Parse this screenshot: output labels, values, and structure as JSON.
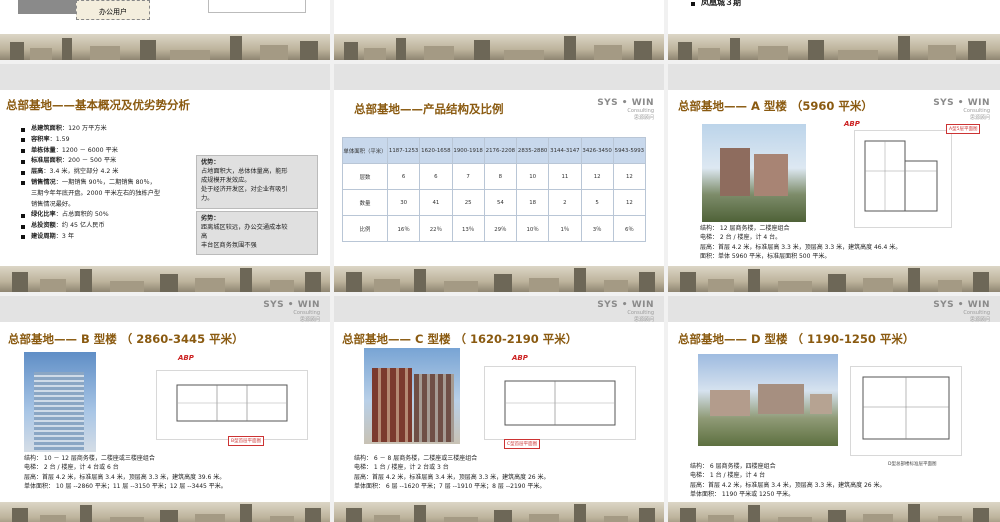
{
  "top_row": {
    "left_box_text": "办公用户",
    "right_bullet": "凤凰城３期"
  },
  "brand": {
    "logo": "SYS • WIN",
    "sub1": "Consulting",
    "sub2": "思源顾问"
  },
  "slide1": {
    "title": "总部基地——基本概况及优劣势分析",
    "bullets": [
      {
        "label": "总建筑面积",
        "value": "：120 万平方米"
      },
      {
        "label": "容积率",
        "value": "：1.59"
      },
      {
        "label": "单栋体量",
        "value": "：1200 － 6000 平米"
      },
      {
        "label": "标准层面积",
        "value": "：200 － 500 平米"
      },
      {
        "label": "层高",
        "value": "：3.4 米，挑空部分 4.2 米"
      },
      {
        "label": "销售情况",
        "value": "：一期销售 90％，二期销售 80％，",
        "extra": [
          "三期今年年底开盘。2000 平米左右的独栋户型",
          "销售情况最好。"
        ]
      },
      {
        "label": "绿化比率",
        "value": "：占总面积的 50%"
      },
      {
        "label": "总投资额",
        "value": "：约 45 亿人民币"
      },
      {
        "label": "建设周期",
        "value": "：3 年"
      }
    ],
    "adv_title": "优势：",
    "adv_lines": [
      "占地面积大，总体体量高，能形",
      "成规模开发效应。",
      "处于经济开发区，对企业有吸引",
      "力。"
    ],
    "dis_title": "劣势：",
    "dis_lines": [
      "距离城区较远，办公交通成本较",
      "高",
      "丰台区商务氛围不强"
    ]
  },
  "slide2": {
    "title": "总部基地——产品结构及比例",
    "table": {
      "header": [
        "单体面积（平米）",
        "1187-1253",
        "1620-1658",
        "1900-1918",
        "2176-2208",
        "2835-2880",
        "3144-3147",
        "3426-3450",
        "5943-5993"
      ],
      "rows": [
        [
          "层数",
          "6",
          "6",
          "7",
          "8",
          "10",
          "11",
          "12",
          "12"
        ],
        [
          "数量",
          "30",
          "41",
          "25",
          "54",
          "18",
          "2",
          "5",
          "12"
        ],
        [
          "比例",
          "16％",
          "22％",
          "13％",
          "29％",
          "10％",
          "1％",
          "3％",
          "6％"
        ]
      ]
    }
  },
  "slide3": {
    "title": "总部基地—— A 型楼 （5960 平米）",
    "brand_mark": "ABP",
    "plan_tag": "A型5层平面图",
    "caption": [
      "结构： 12 层商务楼，二楼座组合",
      "电梯： 2 台 / 楼座，计 4 台。",
      "层高：首层 4.2 米，标准层高 3.3 米，顶层高 3.3 米，建筑高度 46.4 米。",
      "面积：单体 5960 平米，标准层面积 500 平米。"
    ]
  },
  "slide4": {
    "title": "总部基地—— B 型楼 （ 2860-3445 平米）",
    "brand_mark": "ABP",
    "plan_tag": "B型首层平面图",
    "caption": [
      "结构： 10 － 12 层商务楼，二楼座或三楼座组合",
      "电梯： 2 台 / 楼座，计 4 台或 6 台",
      "层高：首层 4.2 米，标准层高 3.4 米，顶层高 3.3 米，建筑高度 39.6 米。",
      "单体面积： 10 层 --2860 平米；11 层 --3150 平米；12 层 --3445 平米。"
    ]
  },
  "slide5": {
    "title": "总部基地—— C 型楼 （ 1620-2190 平米）",
    "brand_mark": "ABP",
    "plan_tag": "C型首层平面图",
    "caption": [
      "结构： 6 － 8 层商务楼，二楼座或三楼座组合",
      "电梯： 1 台 / 楼座，计 2 台或 3 台",
      "层高：首层 4.2 米，标准层高 3.4 米，顶层高 3.3 米，建筑高度 26 米。",
      "单体面积： 6 层 --1620 平米；7 层 --1910 平米；8 层 --2190 平米。"
    ]
  },
  "slide6": {
    "title": "总部基地—— D 型楼 （ 1190-1250 平米）",
    "plan_note": "D型总部楼标准层平面图",
    "caption": [
      "结构： 6 层商务楼，四楼座组合",
      "电梯： 1 台 / 楼座，计 4 台",
      "层高：首层 4.2 米，标准层高 3.4 米，顶层高 3.3 米，建筑高度 26 米。",
      "单体面积： 1190 平米或 1250 平米。"
    ]
  }
}
